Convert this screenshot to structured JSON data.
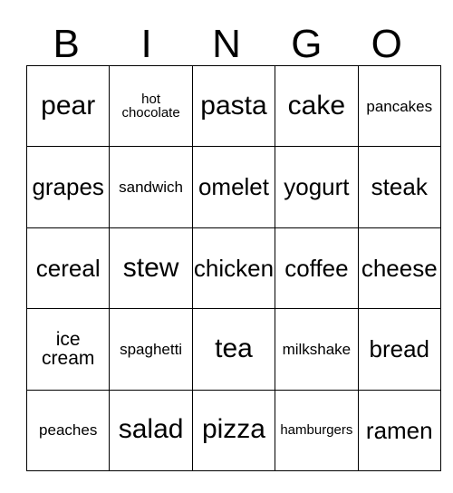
{
  "card": {
    "title": "BINGO",
    "header_letters": [
      "B",
      "I",
      "N",
      "G",
      "O"
    ],
    "rows": 5,
    "columns": 5,
    "border_color": "#000000",
    "text_color": "#000000",
    "background_color": "#ffffff",
    "cells": [
      [
        {
          "label": "pear",
          "size": "sz-xl"
        },
        {
          "label": "hot\nchocolate",
          "size": "sz-xs"
        },
        {
          "label": "pasta",
          "size": "sz-xl"
        },
        {
          "label": "cake",
          "size": "sz-xl"
        },
        {
          "label": "pancakes",
          "size": "sz-sm"
        }
      ],
      [
        {
          "label": "grapes",
          "size": "sz-lg"
        },
        {
          "label": "sandwich",
          "size": "sz-sm"
        },
        {
          "label": "omelet",
          "size": "sz-lg"
        },
        {
          "label": "yogurt",
          "size": "sz-lg"
        },
        {
          "label": "steak",
          "size": "sz-lg"
        }
      ],
      [
        {
          "label": "cereal",
          "size": "sz-lg"
        },
        {
          "label": "stew",
          "size": "sz-xl"
        },
        {
          "label": "chicken",
          "size": "sz-lg"
        },
        {
          "label": "coffee",
          "size": "sz-lg"
        },
        {
          "label": "cheese",
          "size": "sz-lg"
        }
      ],
      [
        {
          "label": "ice\ncream",
          "size": "sz-md"
        },
        {
          "label": "spaghetti",
          "size": "sz-sm"
        },
        {
          "label": "tea",
          "size": "sz-xl"
        },
        {
          "label": "milkshake",
          "size": "sz-sm"
        },
        {
          "label": "bread",
          "size": "sz-lg"
        }
      ],
      [
        {
          "label": "peaches",
          "size": "sz-sm"
        },
        {
          "label": "salad",
          "size": "sz-xl"
        },
        {
          "label": "pizza",
          "size": "sz-xl"
        },
        {
          "label": "hamburgers",
          "size": "sz-xs"
        },
        {
          "label": "ramen",
          "size": "sz-lg"
        }
      ]
    ]
  }
}
